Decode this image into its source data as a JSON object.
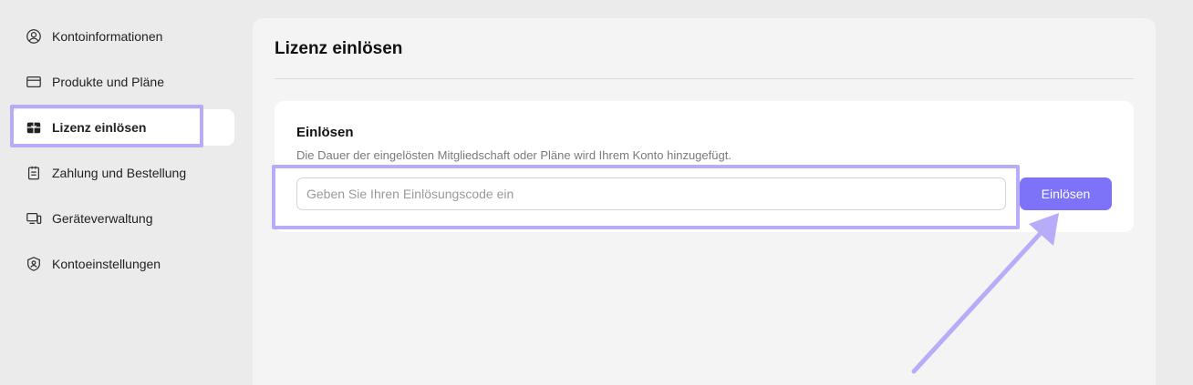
{
  "sidebar": {
    "items": [
      {
        "label": "Kontoinformationen",
        "icon": "user-circle-icon"
      },
      {
        "label": "Produkte und Pläne",
        "icon": "credit-card-icon"
      },
      {
        "label": "Lizenz einlösen",
        "icon": "gift-icon",
        "active": true
      },
      {
        "label": "Zahlung und Bestellung",
        "icon": "clipboard-icon"
      },
      {
        "label": "Geräteverwaltung",
        "icon": "devices-icon"
      },
      {
        "label": "Kontoeinstellungen",
        "icon": "shield-user-icon"
      }
    ]
  },
  "main": {
    "title": "Lizenz einlösen",
    "card": {
      "title": "Einlösen",
      "description": "Die Dauer der eingelösten Mitgliedschaft oder Pläne wird Ihrem Konto hinzugefügt.",
      "input_placeholder": "Geben Sie Ihren Einlösungscode ein",
      "input_value": "",
      "button_label": "Einlösen"
    }
  },
  "colors": {
    "accent": "#7c73f8",
    "highlight": "#b7acf7",
    "background": "#ebebeb",
    "panel": "#f4f4f4"
  }
}
